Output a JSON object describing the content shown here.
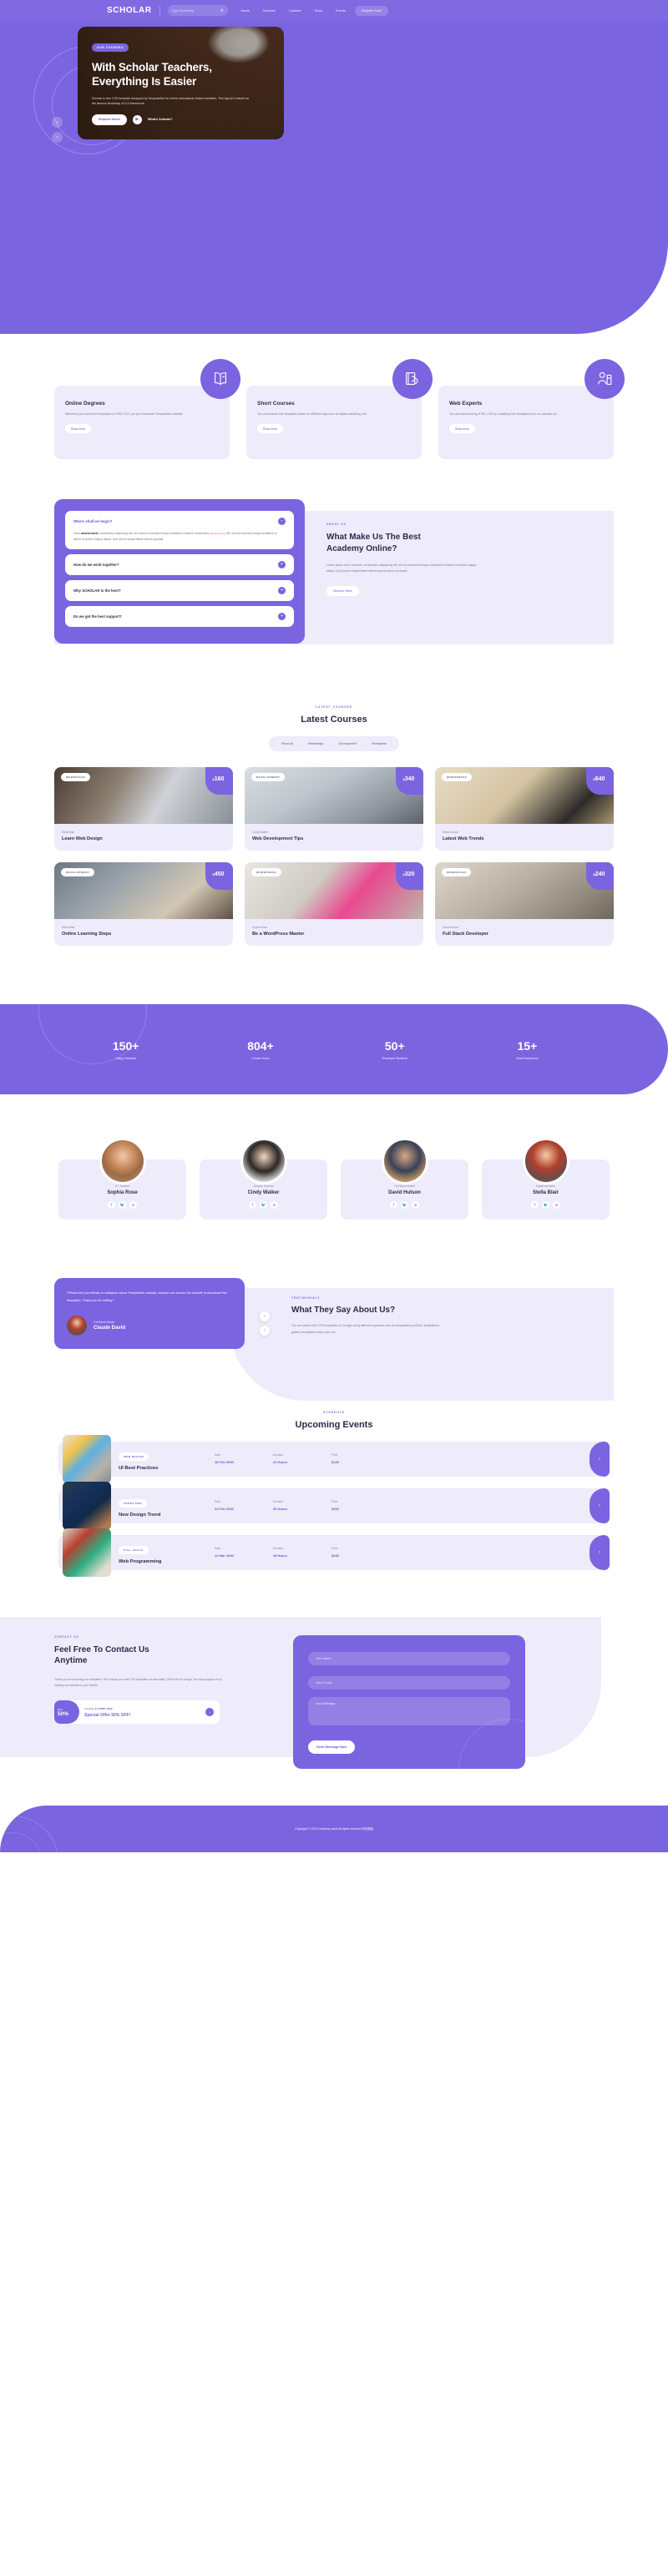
{
  "nav": {
    "logo": "SCHOLAR",
    "search_placeholder": "Type Something",
    "search_value": "",
    "search_icon": "search-icon",
    "links": [
      "Home",
      "Services",
      "Courses",
      "Team",
      "Events"
    ],
    "register_label": "Register Now!"
  },
  "hero": {
    "badge": "OUR COURSES",
    "title_line1": "With Scholar Teachers,",
    "title_line2": "Everything Is Easier",
    "paragraph": "Scholar is free CSS template designed by TemplateMo for online educational related websites. This layout is based on the famous Bootstrap v5.3.0 framework.",
    "primary_btn": "Request Demo",
    "play_label": "What's Scholar?",
    "prev_arrow": "‹",
    "next_arrow": "›"
  },
  "features": [
    {
      "icon": "open-book-icon",
      "title": "Online Degrees",
      "text": "Whenever you need free templates in HTML CSS, you just remember TemplateMo website.",
      "button": "Read More"
    },
    {
      "icon": "book-hand-icon",
      "title": "Short Courses",
      "text": "You can browse free templates based on different tags such as digital marketing, etc.",
      "button": "Read More"
    },
    {
      "icon": "teacher-icon",
      "title": "Web Experts",
      "text": "You can start learning HTML CSS by modifying free templates from our website too.",
      "button": "Read More"
    }
  ],
  "about": {
    "eyebrow": "ABOUT US",
    "heading_line1": "What Make Us The Best",
    "heading_line2": "Academy Online?",
    "paragraph": "Lorem ipsum dolor sit amet, consectetur adipiscing elit, sed do eiusmod tempor incididunt ut labore et dolore magna aliqua. Quis ipsum suspendisse ultrices gravid risus commodo.",
    "button": "Discover More",
    "faq": [
      {
        "question": "Where shall we begin?",
        "open": true,
        "toggle": "−",
        "answer_pre": "Dolor ",
        "answer_bold": "aimesit amet",
        "answer_mid": ", consectetur adipiscing elit, sed doesn't eiusmod tempor incididunt ut labore consectetur ",
        "answer_code": "adipiscing",
        "answer_post": " elit, sed do eiusmod tempor incididunt ut labore et dolore magna aliqua. Quis ipsum suspendisse ultrices gravida."
      },
      {
        "question": "How do we work together?",
        "open": false,
        "toggle": "+"
      },
      {
        "question": "Why SCHOLAR is the best?",
        "open": false,
        "toggle": "+"
      },
      {
        "question": "Do we get the best support?",
        "open": false,
        "toggle": "+"
      }
    ]
  },
  "courses": {
    "eyebrow": "LATEST COURSES",
    "heading": "Latest Courses",
    "filters": [
      "Show All",
      "Webdesign",
      "Development",
      "Wordpress"
    ],
    "items": [
      {
        "category": "WEBDESIGN",
        "price": "160",
        "currency": "$",
        "author": "Stella Blair",
        "title": "Learn Web Design"
      },
      {
        "category": "DEVELOPMENT",
        "price": "340",
        "currency": "$",
        "author": "Cindy Walker",
        "title": "Web Development Tips"
      },
      {
        "category": "WORDPRESS",
        "price": "640",
        "currency": "$",
        "author": "David Hutson",
        "title": "Latest Web Trends"
      },
      {
        "category": "DEVELOPMENT",
        "price": "450",
        "currency": "$",
        "author": "Stella Blair",
        "title": "Online Learning Steps"
      },
      {
        "category": "WORDPRESS",
        "price": "320",
        "currency": "$",
        "author": "Sophia Rose",
        "title": "Be a WordPress Master"
      },
      {
        "category": "WEBDESIGN",
        "price": "240",
        "currency": "$",
        "author": "David Hutson",
        "title": "Full Stack Developer"
      }
    ]
  },
  "stats": [
    {
      "number": "150+",
      "label": "Happy Students"
    },
    {
      "number": "804+",
      "label": "Course Hours"
    },
    {
      "number": "50+",
      "label": "Employed Students"
    },
    {
      "number": "15+",
      "label": "Years Experience"
    }
  ],
  "team": [
    {
      "role": "UX Teacher",
      "name": "Sophia Rose",
      "socials": [
        "facebook-icon",
        "twitter-icon",
        "linkedin-icon"
      ]
    },
    {
      "role": "Graphic Teacher",
      "name": "Cindy Walker",
      "socials": [
        "facebook-icon",
        "twitter-icon",
        "linkedin-icon"
      ]
    },
    {
      "role": "Full Stack Master",
      "name": "David Hutson",
      "socials": [
        "facebook-icon",
        "twitter-icon",
        "linkedin-icon"
      ]
    },
    {
      "role": "Digital Animator",
      "name": "Stella Blair",
      "socials": [
        "facebook-icon",
        "twitter-icon",
        "linkedin-icon"
      ]
    }
  ],
  "testimonials": {
    "eyebrow": "TESTIMONIALS",
    "heading": "What They Say About Us?",
    "paragraph": "You can search free CSS templates on Google using different keywords such as templatemo portfolio, templatemo gallery, templatemo blue color, etc.",
    "quote": "\"Please tell your friends or collegues about TemplateMo website. Anyone can access the website to download free templates. Thank you for visiting.\"",
    "author_role": "Full Stack Master",
    "author_name": "Claude David",
    "prev_arrow": "‹",
    "next_arrow": "›"
  },
  "events": {
    "eyebrow": "SCHEDULE",
    "heading": "Upcoming Events",
    "labels": {
      "date": "Date:",
      "duration": "Duration:",
      "price": "Price:"
    },
    "items": [
      {
        "category": "WEB DESIGN",
        "title": "UI Best Practices",
        "date": "16 Feb 2036",
        "duration": "22 Hours",
        "price": "$120",
        "arrow": "›"
      },
      {
        "category": "FRONT END",
        "title": "New Design Trend",
        "date": "24 Feb 2036",
        "duration": "30 Hours",
        "price": "$320",
        "arrow": "›"
      },
      {
        "category": "FULL STACK",
        "title": "Web Programming",
        "date": "12 Mar 2036",
        "duration": "48 Hours",
        "price": "$440",
        "arrow": "›"
      }
    ]
  },
  "contact": {
    "eyebrow": "CONTACT US",
    "heading_line1": "Feel Free To Contact Us",
    "heading_line2": "Anytime",
    "paragraph": "Thank you for choosing our templates. We provide you best CSS templates at absolutely 100% free of charge. You may support us by sharing our website to your friends.",
    "offer": {
      "off_label": "OFF",
      "off_value": "50%",
      "valid_prefix": "VALIDE: ",
      "valid_date": "24 APRIL 2036",
      "title_pre": "Special Offer ",
      "title_accent": "50%",
      "title_post": " OFF!",
      "arrow": "›"
    },
    "form": {
      "name_placeholder": "Your Name...",
      "name_value": "",
      "email_placeholder": "Your E-mail...",
      "email_value": "",
      "message_placeholder": "Your Message",
      "message_value": "",
      "submit_label": "Send Message Now"
    }
  },
  "footer": {
    "copyright": "Copyright © 2023 Company name All rights reserved 网页模板"
  },
  "colors": {
    "brand": "#7a64e0",
    "brand_dark": "#6b55d2",
    "light": "#eeecfb",
    "text": "#2b2b48",
    "muted": "#7b7b90",
    "accent_pink": "#e0557c"
  }
}
